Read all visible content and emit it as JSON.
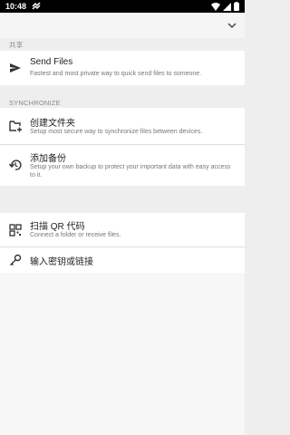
{
  "status": {
    "time": "10:48"
  },
  "sections": {
    "share": "共享",
    "sync": "SYNCHRONIZE"
  },
  "items": {
    "send_files": {
      "title": "Send Files",
      "sub": "Fastest and most private way to quick send files to someone."
    },
    "create_folder": {
      "title": "创建文件夹",
      "sub": "Setup most secure way to synchronize files between devices."
    },
    "add_backup": {
      "title": "添加备份",
      "sub": "Setup your own backup to protect your important data with easy access to it."
    },
    "scan_qr": {
      "title": "扫描 QR 代码",
      "sub": "Connect a folder or receive files."
    },
    "enter_key": {
      "title": "输入密钥或链接"
    }
  },
  "colors": {
    "background": "#eeeeee",
    "card": "#ffffff",
    "status_bar": "#000000"
  },
  "icons": [
    "send-icon",
    "add-folder-icon",
    "backup-restore-icon",
    "qr-code-icon",
    "key-icon",
    "chevron-down-icon"
  ]
}
